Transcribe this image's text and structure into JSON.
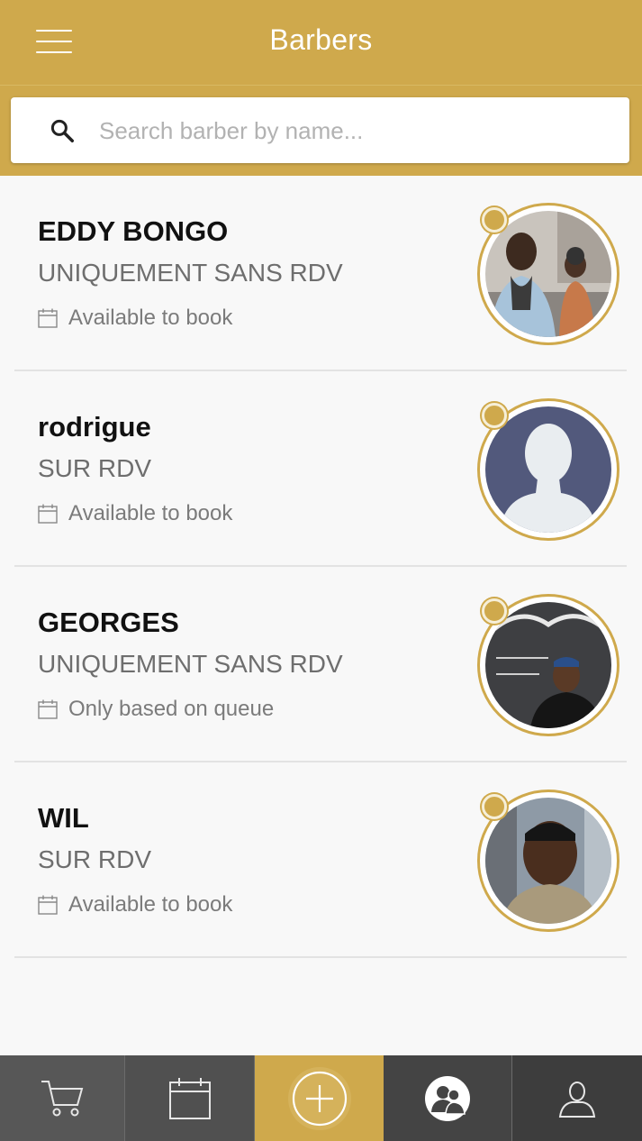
{
  "header": {
    "title": "Barbers",
    "menu_icon": "hamburger-icon"
  },
  "search": {
    "placeholder": "Search barber by name...",
    "value": "",
    "icon": "search-icon"
  },
  "colors": {
    "brand": "#cfa94c",
    "tab_dark": "#4f4f4f",
    "tab_active": "#cfa94c"
  },
  "barbers": [
    {
      "name": "EDDY BONGO",
      "type": "UNIQUEMENT SANS RDV",
      "status": "Available to book",
      "avatar": "photo-two-people"
    },
    {
      "name": "rodrigue",
      "type": "SUR RDV",
      "status": "Available to book",
      "avatar": "default-silhouette"
    },
    {
      "name": "GEORGES",
      "type": "UNIQUEMENT SANS RDV",
      "status": "Only based on queue",
      "avatar": "photo-barbershop"
    },
    {
      "name": "WIL",
      "type": "SUR RDV",
      "status": "Available to book",
      "avatar": "photo-portrait"
    }
  ],
  "tabs": [
    {
      "name": "cart",
      "icon": "cart-icon",
      "active": false
    },
    {
      "name": "calendar",
      "icon": "calendar-icon",
      "active": false
    },
    {
      "name": "add",
      "icon": "plus-circle-icon",
      "active": true
    },
    {
      "name": "barbers",
      "icon": "group-icon",
      "active": false
    },
    {
      "name": "profile",
      "icon": "user-icon",
      "active": false
    }
  ]
}
